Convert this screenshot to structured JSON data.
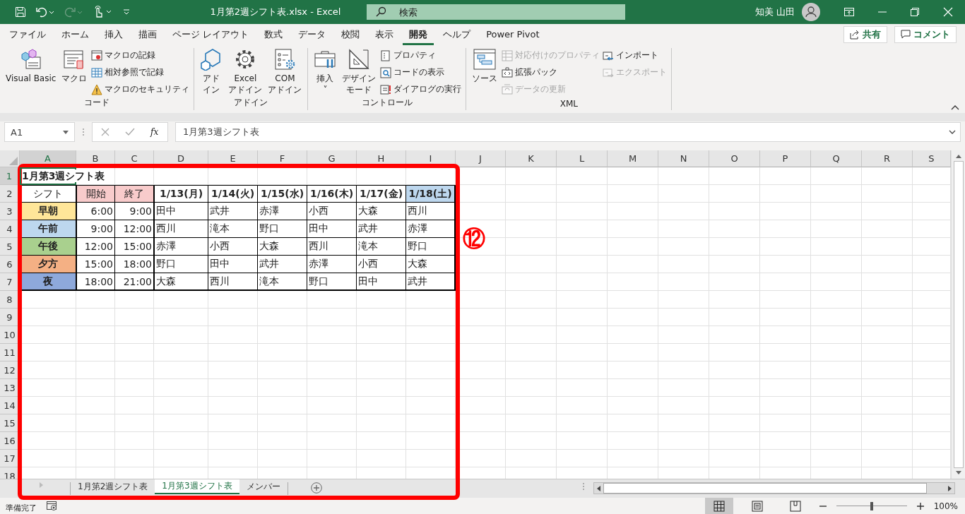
{
  "title_bar": {
    "title": "1月第2週シフト表.xlsx  -  Excel",
    "search": {
      "placeholder": "検索"
    },
    "user": "知美 山田"
  },
  "ribbon_tabs": [
    {
      "label": "ファイル",
      "selected": false
    },
    {
      "label": "ホーム",
      "selected": false
    },
    {
      "label": "挿入",
      "selected": false
    },
    {
      "label": "描画",
      "selected": false
    },
    {
      "label": "ページ レイアウト",
      "selected": false
    },
    {
      "label": "数式",
      "selected": false
    },
    {
      "label": "データ",
      "selected": false
    },
    {
      "label": "校閲",
      "selected": false
    },
    {
      "label": "表示",
      "selected": false
    },
    {
      "label": "開発",
      "selected": true
    },
    {
      "label": "ヘルプ",
      "selected": false
    },
    {
      "label": "Power Pivot",
      "selected": false
    }
  ],
  "ribbon_actions": [
    "共有",
    "コメント"
  ],
  "ribbon_groups": [
    {
      "label": "コード",
      "items": [
        {
          "kind": "large",
          "lines": [
            "Visual Basic"
          ],
          "disabled": false
        },
        {
          "kind": "large",
          "lines": [
            "マクロ"
          ],
          "disabled": false
        },
        {
          "kind": "column",
          "items": [
            {
              "label": "マクロの記録",
              "disabled": false
            },
            {
              "label": "相対参照で記録",
              "disabled": false
            },
            {
              "label": "マクロのセキュリティ",
              "disabled": false
            }
          ]
        }
      ]
    },
    {
      "label": "アドイン",
      "items": [
        {
          "kind": "large",
          "lines": [
            "アド",
            "イン"
          ],
          "disabled": false
        },
        {
          "kind": "large",
          "lines": [
            "Excel",
            "アドイン"
          ],
          "disabled": false
        },
        {
          "kind": "large",
          "lines": [
            "COM",
            "アドイン"
          ],
          "disabled": false
        }
      ]
    },
    {
      "label": "コントロール",
      "items": [
        {
          "kind": "large",
          "lines": [
            "挿入",
            "˅"
          ],
          "disabled": false
        },
        {
          "kind": "large",
          "lines": [
            "デザイン",
            "モード"
          ],
          "disabled": false
        },
        {
          "kind": "column",
          "items": [
            {
              "label": "プロパティ",
              "disabled": false
            },
            {
              "label": "コードの表示",
              "disabled": false
            },
            {
              "label": "ダイアログの実行",
              "disabled": false
            }
          ]
        }
      ]
    },
    {
      "label": "XML",
      "items": [
        {
          "kind": "large",
          "lines": [
            "ソース"
          ],
          "disabled": false
        },
        {
          "kind": "column",
          "items": [
            {
              "label": "対応付けのプロパティ",
              "disabled": true
            },
            {
              "label": "拡張パック",
              "disabled": false
            },
            {
              "label": "データの更新",
              "disabled": true
            }
          ]
        },
        {
          "kind": "column",
          "items": [
            {
              "label": "インポート",
              "disabled": false
            },
            {
              "label": "エクスポート",
              "disabled": true
            }
          ]
        }
      ]
    }
  ],
  "formula_bar": {
    "name_box": "A1",
    "function_label": "fx",
    "formula": "1月第3週シフト表"
  },
  "columns": [
    {
      "label": "A",
      "selected": true
    },
    {
      "label": "B",
      "selected": false
    },
    {
      "label": "C",
      "selected": false
    },
    {
      "label": "D",
      "selected": false
    },
    {
      "label": "E",
      "selected": false
    },
    {
      "label": "F",
      "selected": false
    },
    {
      "label": "G",
      "selected": false
    },
    {
      "label": "H",
      "selected": false
    },
    {
      "label": "I",
      "selected": false
    },
    {
      "label": "J",
      "selected": false
    },
    {
      "label": "K",
      "selected": false
    },
    {
      "label": "L",
      "selected": false
    },
    {
      "label": "M",
      "selected": false
    },
    {
      "label": "N",
      "selected": false
    },
    {
      "label": "O",
      "selected": false
    },
    {
      "label": "P",
      "selected": false
    },
    {
      "label": "Q",
      "selected": false
    },
    {
      "label": "R",
      "selected": false
    },
    {
      "label": "S",
      "selected": false
    }
  ],
  "row_numbers": [
    {
      "label": "1",
      "selected": true
    },
    {
      "label": "2",
      "selected": false
    },
    {
      "label": "3",
      "selected": false
    },
    {
      "label": "4",
      "selected": false
    },
    {
      "label": "5",
      "selected": false
    },
    {
      "label": "6",
      "selected": false
    },
    {
      "label": "7",
      "selected": false
    },
    {
      "label": "8",
      "selected": false
    },
    {
      "label": "9",
      "selected": false
    },
    {
      "label": "10",
      "selected": false
    },
    {
      "label": "11",
      "selected": false
    },
    {
      "label": "12",
      "selected": false
    },
    {
      "label": "13",
      "selected": false
    },
    {
      "label": "14",
      "selected": false
    },
    {
      "label": "15",
      "selected": false
    },
    {
      "label": "16",
      "selected": false
    },
    {
      "label": "17",
      "selected": false
    },
    {
      "label": "18",
      "selected": false
    }
  ],
  "table_rows": [
    {
      "cells": [
        {
          "kind": "title",
          "text": "1月第3週シフト表"
        }
      ]
    },
    {
      "cells": [
        {
          "kind": "label",
          "text": "シフト"
        },
        {
          "kind": "label",
          "text": "開始",
          "color": "#f8cbcb"
        },
        {
          "kind": "label",
          "text": "終了",
          "color": "#f8cbcb"
        },
        {
          "kind": "date",
          "text": "1/13(月)"
        },
        {
          "kind": "date",
          "text": "1/14(火)"
        },
        {
          "kind": "date",
          "text": "1/15(水)"
        },
        {
          "kind": "date",
          "text": "1/16(木)"
        },
        {
          "kind": "date",
          "text": "1/17(金)"
        },
        {
          "kind": "date",
          "text": "1/18(土)",
          "color": "#bdd7ee"
        }
      ]
    },
    {
      "cells": [
        {
          "kind": "shift",
          "text": "早朝",
          "color": "#ffe699"
        },
        {
          "kind": "time",
          "text": "6:00"
        },
        {
          "kind": "time",
          "text": "9:00"
        },
        {
          "kind": "name",
          "text": "田中"
        },
        {
          "kind": "name",
          "text": "武井"
        },
        {
          "kind": "name",
          "text": "赤澤"
        },
        {
          "kind": "name",
          "text": "小西"
        },
        {
          "kind": "name",
          "text": "大森"
        },
        {
          "kind": "name",
          "text": "西川"
        }
      ]
    },
    {
      "cells": [
        {
          "kind": "shift",
          "text": "午前",
          "color": "#bdd7ee"
        },
        {
          "kind": "time",
          "text": "9:00"
        },
        {
          "kind": "time",
          "text": "12:00"
        },
        {
          "kind": "name",
          "text": "西川"
        },
        {
          "kind": "name",
          "text": "滝本"
        },
        {
          "kind": "name",
          "text": "野口"
        },
        {
          "kind": "name",
          "text": "田中"
        },
        {
          "kind": "name",
          "text": "武井"
        },
        {
          "kind": "name",
          "text": "赤澤"
        }
      ]
    },
    {
      "cells": [
        {
          "kind": "shift",
          "text": "午後",
          "color": "#a9d08e"
        },
        {
          "kind": "time",
          "text": "12:00"
        },
        {
          "kind": "time",
          "text": "15:00"
        },
        {
          "kind": "name",
          "text": "赤澤"
        },
        {
          "kind": "name",
          "text": "小西"
        },
        {
          "kind": "name",
          "text": "大森"
        },
        {
          "kind": "name",
          "text": "西川"
        },
        {
          "kind": "name",
          "text": "滝本"
        },
        {
          "kind": "name",
          "text": "野口"
        }
      ]
    },
    {
      "cells": [
        {
          "kind": "shift",
          "text": "夕方",
          "color": "#f4b084"
        },
        {
          "kind": "time",
          "text": "15:00"
        },
        {
          "kind": "time",
          "text": "18:00"
        },
        {
          "kind": "name",
          "text": "野口"
        },
        {
          "kind": "name",
          "text": "田中"
        },
        {
          "kind": "name",
          "text": "武井"
        },
        {
          "kind": "name",
          "text": "赤澤"
        },
        {
          "kind": "name",
          "text": "小西"
        },
        {
          "kind": "name",
          "text": "大森"
        }
      ]
    },
    {
      "cells": [
        {
          "kind": "shift",
          "text": "夜",
          "color": "#8ea9db"
        },
        {
          "kind": "time",
          "text": "18:00"
        },
        {
          "kind": "time",
          "text": "21:00"
        },
        {
          "kind": "name",
          "text": "大森"
        },
        {
          "kind": "name",
          "text": "西川"
        },
        {
          "kind": "name",
          "text": "滝本"
        },
        {
          "kind": "name",
          "text": "野口"
        },
        {
          "kind": "name",
          "text": "田中"
        },
        {
          "kind": "name",
          "text": "武井"
        }
      ]
    }
  ],
  "sheet_tabs": [
    {
      "label": "1月第2週シフト表",
      "selected": false
    },
    {
      "label": "1月第3週シフト表",
      "selected": true
    },
    {
      "label": "メンバー",
      "selected": false
    }
  ],
  "status_bar": {
    "text": "準備完了",
    "views": [
      {
        "selected": true
      },
      {
        "selected": false
      },
      {
        "selected": false
      }
    ],
    "zoom": {
      "level": 0.5,
      "reading": "100%"
    }
  },
  "annotation": {
    "label": "⑫"
  }
}
